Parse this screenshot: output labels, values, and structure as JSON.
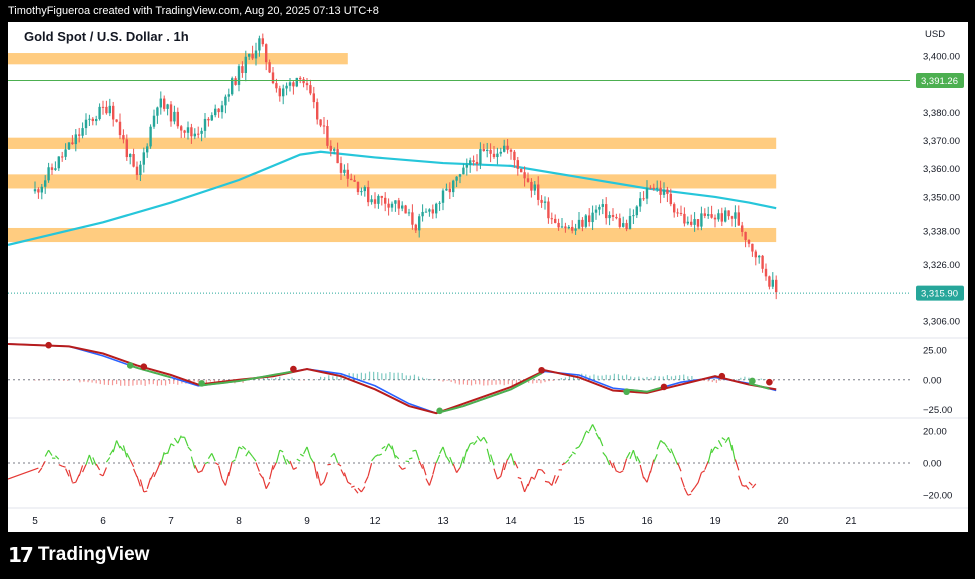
{
  "header": {
    "attribution": "TimothyFigueroa created with TradingView.com, Aug 20, 2025 07:13 UTC+8"
  },
  "footer": {
    "brand": "TradingView",
    "logo_glyph": "17"
  },
  "colors": {
    "up": "#26a69a",
    "down": "#ef5350",
    "zone": "#ffcc80",
    "ma": "#26c6da",
    "price_line": "#4caf50",
    "macd_fast": "#2962ff",
    "macd_slow": "#b71c1c",
    "macd_bull": "#4caf50",
    "osc_up": "#4cd137",
    "osc_down": "#e53935"
  },
  "chart_data": [
    {
      "type": "candlestick",
      "title": "Gold Spot / U.S. Dollar . 1h",
      "currency": "USD",
      "ylim": [
        3300,
        3412
      ],
      "yticks": [
        3306,
        3326,
        3338,
        3350,
        3360,
        3370,
        3380,
        3400
      ],
      "ytick_labels": [
        "3,306.00",
        "3,326.00",
        "3,338.00",
        "3,350.00",
        "3,360.00",
        "3,370.00",
        "3,380.00",
        "3,400.00"
      ],
      "x_labels": [
        "5",
        "6",
        "7",
        "8",
        "9",
        "12",
        "13",
        "14",
        "15",
        "16",
        "19",
        "20",
        "21"
      ],
      "price_anchors": [
        {
          "x": 0,
          "y": 3352
        },
        {
          "x": 0.8,
          "y": 3377
        },
        {
          "x": 1.1,
          "y": 3383
        },
        {
          "x": 1.5,
          "y": 3356
        },
        {
          "x": 1.8,
          "y": 3384
        },
        {
          "x": 2.3,
          "y": 3372
        },
        {
          "x": 2.6,
          "y": 3378
        },
        {
          "x": 3.0,
          "y": 3394
        },
        {
          "x": 3.3,
          "y": 3405
        },
        {
          "x": 3.6,
          "y": 3386
        },
        {
          "x": 3.9,
          "y": 3394
        },
        {
          "x": 4.2,
          "y": 3375
        },
        {
          "x": 4.5,
          "y": 3361
        },
        {
          "x": 4.9,
          "y": 3350
        },
        {
          "x": 5.3,
          "y": 3348
        },
        {
          "x": 5.6,
          "y": 3340
        },
        {
          "x": 6.0,
          "y": 3350
        },
        {
          "x": 6.5,
          "y": 3364
        },
        {
          "x": 6.9,
          "y": 3368
        },
        {
          "x": 7.2,
          "y": 3358
        },
        {
          "x": 7.6,
          "y": 3343
        },
        {
          "x": 7.9,
          "y": 3338
        },
        {
          "x": 8.3,
          "y": 3346
        },
        {
          "x": 8.7,
          "y": 3339
        },
        {
          "x": 9.05,
          "y": 3355
        },
        {
          "x": 9.3,
          "y": 3350
        },
        {
          "x": 9.6,
          "y": 3340
        },
        {
          "x": 9.9,
          "y": 3343
        },
        {
          "x": 10.3,
          "y": 3343
        },
        {
          "x": 10.6,
          "y": 3330
        },
        {
          "x": 10.9,
          "y": 3316
        }
      ],
      "zones": [
        {
          "low": 3397,
          "high": 3401,
          "from": 0,
          "to": 4.6
        },
        {
          "low": 3367,
          "high": 3371,
          "from": 0,
          "to": 10.9
        },
        {
          "low": 3353,
          "high": 3358,
          "from": 0,
          "to": 10.9
        },
        {
          "low": 3334,
          "high": 3339,
          "from": 0,
          "to": 10.9
        }
      ],
      "horizontal_line": {
        "value": 3391.26,
        "label": "3,391.26"
      },
      "last_price": {
        "value": 3315.9,
        "label": "3,315.90"
      },
      "moving_average": [
        {
          "x": 0,
          "y": 3333
        },
        {
          "x": 1,
          "y": 3341
        },
        {
          "x": 2,
          "y": 3348
        },
        {
          "x": 3,
          "y": 3356
        },
        {
          "x": 3.9,
          "y": 3365
        },
        {
          "x": 4.2,
          "y": 3366
        },
        {
          "x": 5,
          "y": 3364
        },
        {
          "x": 6,
          "y": 3362
        },
        {
          "x": 7,
          "y": 3361
        },
        {
          "x": 8,
          "y": 3357
        },
        {
          "x": 9,
          "y": 3353
        },
        {
          "x": 10,
          "y": 3350
        },
        {
          "x": 10.5,
          "y": 3348
        },
        {
          "x": 10.9,
          "y": 3346
        }
      ]
    },
    {
      "type": "line",
      "name": "macd",
      "ylim": [
        -32,
        35
      ],
      "yticks": [
        25,
        0,
        -25
      ],
      "ytick_labels": [
        "25.00",
        "0.00",
        "−25.00"
      ],
      "fast": [
        {
          "x": 0,
          "y": 30
        },
        {
          "x": 0.5,
          "y": 28
        },
        {
          "x": 1,
          "y": 20
        },
        {
          "x": 1.5,
          "y": 10
        },
        {
          "x": 2,
          "y": 2
        },
        {
          "x": 2.4,
          "y": -5
        },
        {
          "x": 3,
          "y": -1
        },
        {
          "x": 3.5,
          "y": 4
        },
        {
          "x": 4,
          "y": 9
        },
        {
          "x": 4.5,
          "y": 5
        },
        {
          "x": 5,
          "y": -5
        },
        {
          "x": 5.5,
          "y": -20
        },
        {
          "x": 5.9,
          "y": -28
        },
        {
          "x": 6.3,
          "y": -22
        },
        {
          "x": 7,
          "y": -8
        },
        {
          "x": 7.5,
          "y": 7
        },
        {
          "x": 8,
          "y": 4
        },
        {
          "x": 8.5,
          "y": -7
        },
        {
          "x": 9,
          "y": -10
        },
        {
          "x": 9.5,
          "y": -2
        },
        {
          "x": 10,
          "y": 2
        },
        {
          "x": 10.5,
          "y": -3
        },
        {
          "x": 10.9,
          "y": -9
        }
      ],
      "slow": [
        {
          "x": 0,
          "y": 30
        },
        {
          "x": 0.5,
          "y": 28
        },
        {
          "x": 1,
          "y": 22
        },
        {
          "x": 1.5,
          "y": 12
        },
        {
          "x": 2,
          "y": 4
        },
        {
          "x": 2.4,
          "y": -4
        },
        {
          "x": 3,
          "y": 0
        },
        {
          "x": 3.5,
          "y": 3
        },
        {
          "x": 4,
          "y": 9
        },
        {
          "x": 4.5,
          "y": 3
        },
        {
          "x": 5,
          "y": -8
        },
        {
          "x": 5.5,
          "y": -22
        },
        {
          "x": 5.9,
          "y": -28
        },
        {
          "x": 6.3,
          "y": -20
        },
        {
          "x": 7,
          "y": -6
        },
        {
          "x": 7.5,
          "y": 8
        },
        {
          "x": 8,
          "y": 2
        },
        {
          "x": 8.5,
          "y": -9
        },
        {
          "x": 9,
          "y": -11
        },
        {
          "x": 9.5,
          "y": -4
        },
        {
          "x": 10,
          "y": 3
        },
        {
          "x": 10.5,
          "y": -4
        },
        {
          "x": 10.9,
          "y": -8
        }
      ],
      "markers": [
        {
          "x": 0.2,
          "y": 29,
          "kind": "bear"
        },
        {
          "x": 1.4,
          "y": 12,
          "kind": "bull"
        },
        {
          "x": 1.6,
          "y": 11,
          "kind": "bear"
        },
        {
          "x": 2.45,
          "y": -3,
          "kind": "bull"
        },
        {
          "x": 3.8,
          "y": 9,
          "kind": "bear"
        },
        {
          "x": 5.95,
          "y": -26,
          "kind": "bull"
        },
        {
          "x": 7.45,
          "y": 8,
          "kind": "bear"
        },
        {
          "x": 8.7,
          "y": -10,
          "kind": "bull"
        },
        {
          "x": 9.25,
          "y": -6,
          "kind": "bear"
        },
        {
          "x": 10.1,
          "y": 3,
          "kind": "bear"
        },
        {
          "x": 10.55,
          "y": -1,
          "kind": "bull"
        },
        {
          "x": 10.8,
          "y": -2,
          "kind": "bear"
        }
      ]
    },
    {
      "type": "line",
      "name": "oscillator",
      "ylim": [
        -28,
        28
      ],
      "yticks": [
        20,
        0,
        -20
      ],
      "ytick_labels": [
        "20.00",
        "0.00",
        "−20.00"
      ],
      "baseline": 0,
      "series": [
        {
          "x": 0,
          "y": -10
        },
        {
          "x": 0.2,
          "y": 8
        },
        {
          "x": 0.4,
          "y": -2
        },
        {
          "x": 0.6,
          "y": -12
        },
        {
          "x": 0.8,
          "y": 5
        },
        {
          "x": 1.0,
          "y": -8
        },
        {
          "x": 1.2,
          "y": 14
        },
        {
          "x": 1.4,
          "y": 2
        },
        {
          "x": 1.6,
          "y": -18
        },
        {
          "x": 1.8,
          "y": -4
        },
        {
          "x": 2.0,
          "y": 12
        },
        {
          "x": 2.2,
          "y": 16
        },
        {
          "x": 2.4,
          "y": -6
        },
        {
          "x": 2.6,
          "y": 6
        },
        {
          "x": 2.8,
          "y": -14
        },
        {
          "x": 3.0,
          "y": 10
        },
        {
          "x": 3.2,
          "y": 4
        },
        {
          "x": 3.4,
          "y": -16
        },
        {
          "x": 3.6,
          "y": 8
        },
        {
          "x": 3.8,
          "y": -4
        },
        {
          "x": 4.0,
          "y": 10
        },
        {
          "x": 4.2,
          "y": -14
        },
        {
          "x": 4.4,
          "y": 6
        },
        {
          "x": 4.6,
          "y": -12
        },
        {
          "x": 4.8,
          "y": -18
        },
        {
          "x": 5.0,
          "y": 4
        },
        {
          "x": 5.2,
          "y": 12
        },
        {
          "x": 5.4,
          "y": -4
        },
        {
          "x": 5.6,
          "y": 8
        },
        {
          "x": 5.8,
          "y": -14
        },
        {
          "x": 6.0,
          "y": 10
        },
        {
          "x": 6.2,
          "y": -6
        },
        {
          "x": 6.4,
          "y": 12
        },
        {
          "x": 6.6,
          "y": 16
        },
        {
          "x": 6.8,
          "y": -10
        },
        {
          "x": 7.0,
          "y": 6
        },
        {
          "x": 7.2,
          "y": -18
        },
        {
          "x": 7.4,
          "y": -4
        },
        {
          "x": 7.6,
          "y": -14
        },
        {
          "x": 7.8,
          "y": 0
        },
        {
          "x": 8.0,
          "y": 10
        },
        {
          "x": 8.2,
          "y": 24
        },
        {
          "x": 8.4,
          "y": 4
        },
        {
          "x": 8.6,
          "y": -6
        },
        {
          "x": 8.8,
          "y": 8
        },
        {
          "x": 9.0,
          "y": -12
        },
        {
          "x": 9.2,
          "y": 14
        },
        {
          "x": 9.4,
          "y": 4
        },
        {
          "x": 9.6,
          "y": -20
        },
        {
          "x": 9.8,
          "y": -6
        },
        {
          "x": 10.0,
          "y": 10
        },
        {
          "x": 10.2,
          "y": 16
        },
        {
          "x": 10.4,
          "y": -14
        },
        {
          "x": 10.6,
          "y": -13
        }
      ]
    }
  ]
}
